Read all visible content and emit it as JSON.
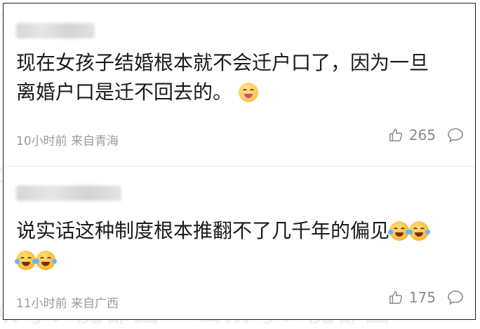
{
  "watermark": "公众号：魔都囡",
  "comments": [
    {
      "text_line1": "现在女孩子结婚根本就不会迁户口了，因为一旦",
      "text_line2": "离婚户口是迁不回去的。",
      "emoji": "yum-face-icon",
      "time": "10小时前",
      "location": "来自青海",
      "likes": "265"
    },
    {
      "text_line1": "说实话这种制度根本推翻不了几千年的偏见",
      "emoji": "tears-of-joy-icon",
      "time": "11小时前",
      "location": "来自广西",
      "likes": "175"
    }
  ],
  "colors": {
    "meta": "#9a9a9a",
    "text": "#1a1a1a",
    "border": "#1f1f1f"
  }
}
